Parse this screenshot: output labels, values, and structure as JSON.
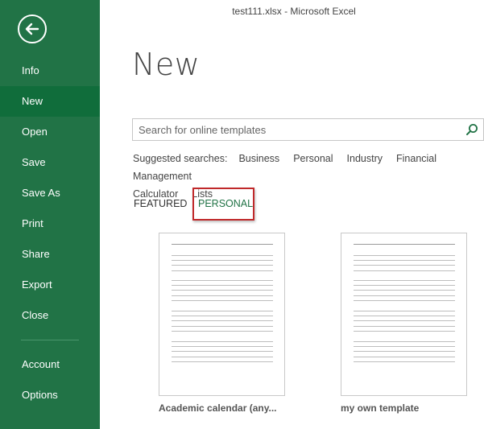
{
  "window": {
    "title": "test111.xlsx - Microsoft Excel"
  },
  "sidebar": {
    "back_label": "Back",
    "items": [
      {
        "label": "Info",
        "active": false
      },
      {
        "label": "New",
        "active": true
      },
      {
        "label": "Open",
        "active": false
      },
      {
        "label": "Save",
        "active": false
      },
      {
        "label": "Save As",
        "active": false
      },
      {
        "label": "Print",
        "active": false
      },
      {
        "label": "Share",
        "active": false
      },
      {
        "label": "Export",
        "active": false
      },
      {
        "label": "Close",
        "active": false
      }
    ],
    "bottom_items": [
      {
        "label": "Account"
      },
      {
        "label": "Options"
      }
    ],
    "colors": {
      "background": "#217346",
      "active": "#106d3b"
    }
  },
  "main": {
    "title": "New",
    "search": {
      "placeholder": "Search for online templates",
      "value": ""
    },
    "suggested": {
      "label": "Suggested searches:",
      "items": [
        "Business",
        "Personal",
        "Industry",
        "Financial Management",
        "Calculator",
        "Lists"
      ]
    },
    "tabs": [
      {
        "label": "FEATURED",
        "selected": false
      },
      {
        "label": "PERSONAL",
        "selected": true
      }
    ],
    "templates": [
      {
        "caption": "Academic calendar (any..."
      },
      {
        "caption": "my own template"
      }
    ],
    "accent_color": "#217346",
    "highlight_color": "#c0282a"
  }
}
